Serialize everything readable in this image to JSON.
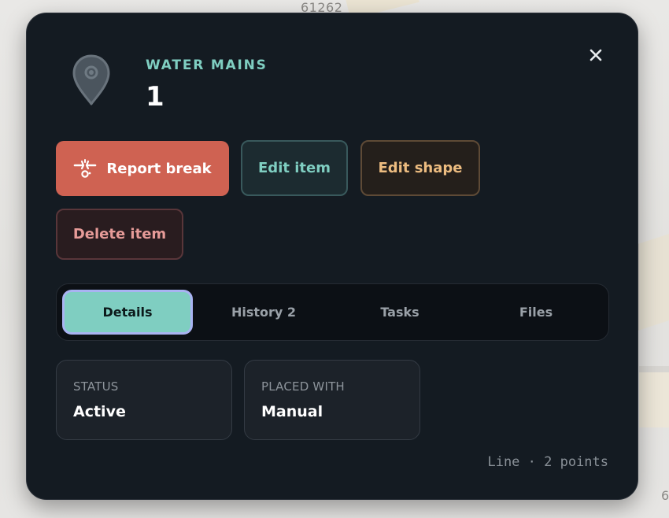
{
  "map": {
    "label_top": "61262",
    "label_corner": "6"
  },
  "popup": {
    "icon": "map-pin-icon",
    "category": "WATER MAINS",
    "item_id": "1",
    "close_icon": "close-icon",
    "actions": {
      "report_break": "Report break",
      "report_break_icon": "pipe-break-icon",
      "edit_item": "Edit item",
      "edit_shape": "Edit shape",
      "delete_item": "Delete item"
    },
    "tabs": [
      {
        "label": "Details",
        "active": true
      },
      {
        "label": "History 2",
        "active": false
      },
      {
        "label": "Tasks",
        "active": false
      },
      {
        "label": "Files",
        "active": false
      }
    ],
    "details": [
      {
        "label": "STATUS",
        "value": "Active"
      },
      {
        "label": "PLACED WITH",
        "value": "Manual"
      }
    ],
    "geometry_summary": "Line · 2 points"
  },
  "colors": {
    "accent_teal": "#7fcec1",
    "report_red": "#cf6252",
    "edit_shape_amber": "#ecbc80",
    "delete_pink": "#e69b98",
    "panel_bg": "#141b22",
    "active_tab_outline": "#a9b3f2"
  }
}
